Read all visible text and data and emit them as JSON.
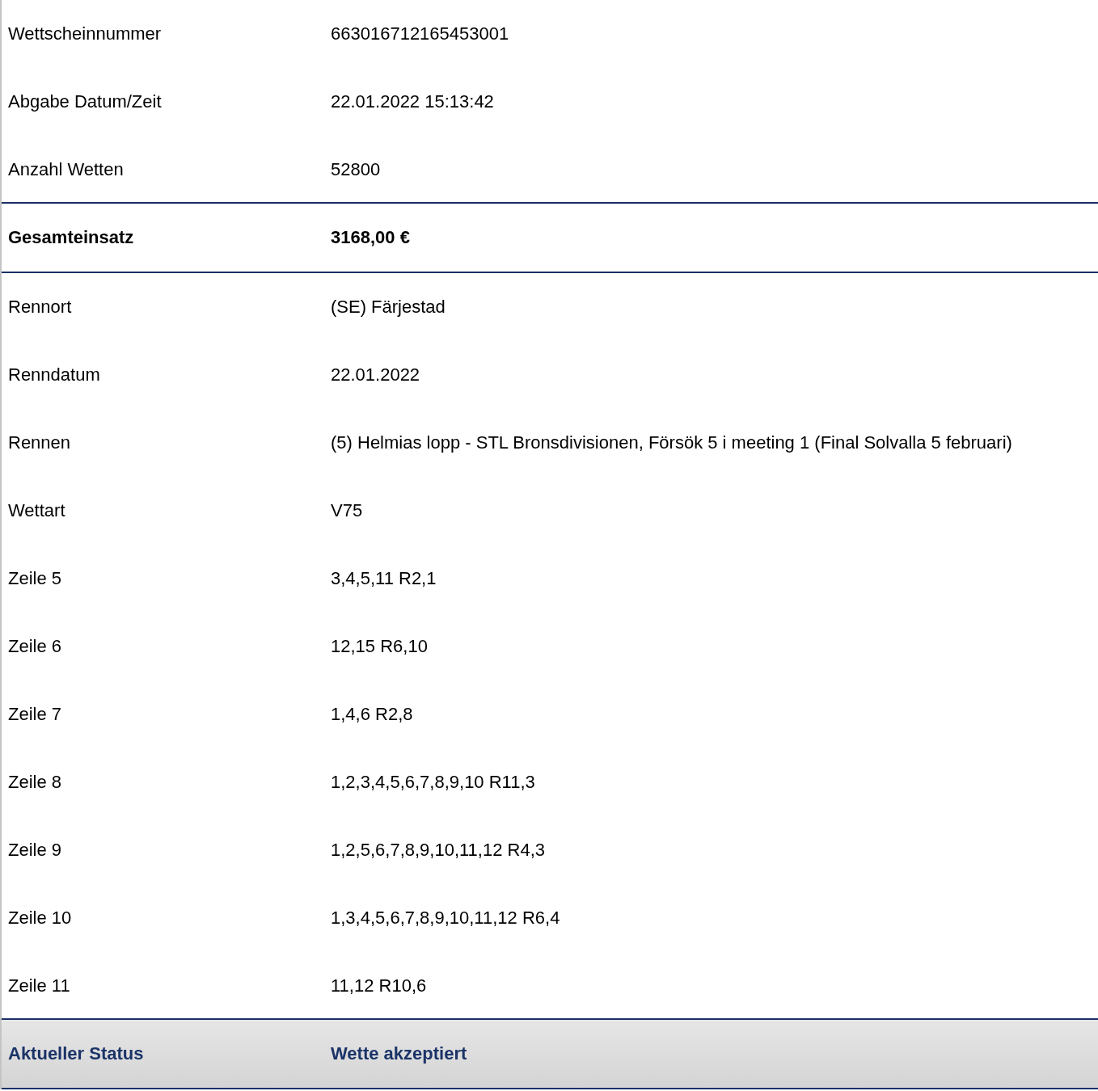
{
  "rows": [
    {
      "kind": "normal",
      "label": "Wettscheinnummer",
      "value": "663016712165453001"
    },
    {
      "kind": "normal",
      "label": "Abgabe Datum/Zeit",
      "value": "22.01.2022 15:13:42"
    },
    {
      "kind": "normal",
      "label": "Anzahl Wetten",
      "value": "52800"
    },
    {
      "kind": "total",
      "label": "Gesamteinsatz",
      "value": "3168,00 €"
    },
    {
      "kind": "normal",
      "label": "Rennort",
      "value": "(SE) Färjestad"
    },
    {
      "kind": "normal",
      "label": "Renndatum",
      "value": "22.01.2022"
    },
    {
      "kind": "normal",
      "label": "Rennen",
      "value": "(5) Helmias lopp - STL Bronsdivisionen, Försök 5 i meeting 1 (Final Solvalla 5 februari)"
    },
    {
      "kind": "normal",
      "label": "Wettart",
      "value": "V75"
    },
    {
      "kind": "normal",
      "label": "Zeile 5",
      "value": "3,4,5,11 R2,1"
    },
    {
      "kind": "normal",
      "label": "Zeile 6",
      "value": "12,15 R6,10"
    },
    {
      "kind": "normal",
      "label": "Zeile 7",
      "value": "1,4,6 R2,8"
    },
    {
      "kind": "normal",
      "label": "Zeile 8",
      "value": "1,2,3,4,5,6,7,8,9,10 R11,3"
    },
    {
      "kind": "normal",
      "label": "Zeile 9",
      "value": "1,2,5,6,7,8,9,10,11,12 R4,3"
    },
    {
      "kind": "normal",
      "label": "Zeile 10",
      "value": "1,3,4,5,6,7,8,9,10,11,12 R6,4"
    },
    {
      "kind": "normal",
      "label": "Zeile 11",
      "value": "11,12 R10,6"
    },
    {
      "kind": "status",
      "label": "Aktueller Status",
      "value": "Wette akzeptiert"
    }
  ]
}
